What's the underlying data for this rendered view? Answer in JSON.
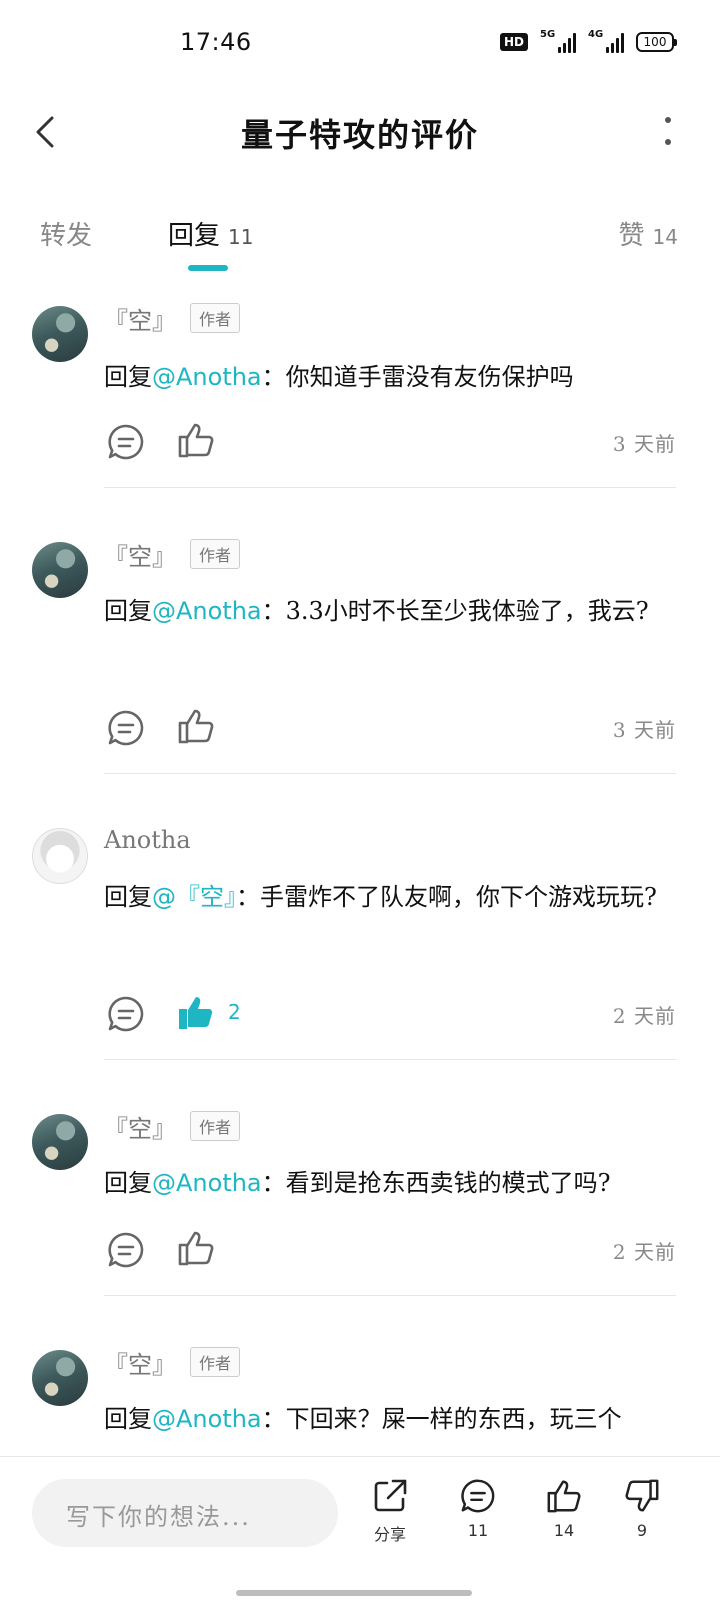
{
  "status_bar": {
    "time": "17:46",
    "hd_label": "HD",
    "network1": "5G",
    "network2": "4G",
    "battery": "100"
  },
  "header": {
    "title": "量子特攻的评价"
  },
  "tabs": [
    {
      "label": "转发",
      "count": ""
    },
    {
      "label": "回复",
      "count": "11"
    },
    {
      "label": "赞",
      "count": "14"
    }
  ],
  "accent_color": "#1fb6c4",
  "comments": [
    {
      "author": "『空』",
      "badge": "作者",
      "prefix": "回复",
      "mention": "@Anotha",
      "text": "：你知道手雷没有友伤保护吗",
      "likes": "",
      "liked": false,
      "time": "3 天前"
    },
    {
      "author": "『空』",
      "badge": "作者",
      "prefix": "回复",
      "mention": "@Anotha",
      "text": "：3.3小时不长至少我体验了，我云?",
      "likes": "",
      "liked": false,
      "time": "3 天前"
    },
    {
      "author": "Anotha",
      "badge": "",
      "prefix": "回复",
      "mention": "@『空』",
      "text": "：手雷炸不了队友啊，你下个游戏玩玩?",
      "likes": "2",
      "liked": true,
      "time": "2 天前"
    },
    {
      "author": "『空』",
      "badge": "作者",
      "prefix": "回复",
      "mention": "@Anotha",
      "text": "：看到是抢东西卖钱的模式了吗?",
      "likes": "",
      "liked": false,
      "time": "2 天前"
    },
    {
      "author": "『空』",
      "badge": "作者",
      "prefix": "回复",
      "mention": "@Anotha",
      "text": "：下回来？屎一样的东西，玩三个",
      "likes": "",
      "liked": false,
      "time": ""
    }
  ],
  "bottom_bar": {
    "input_placeholder": "写下你的想法...",
    "share_label": "分享",
    "reply_count": "11",
    "like_count": "14",
    "dislike_count": "9"
  }
}
